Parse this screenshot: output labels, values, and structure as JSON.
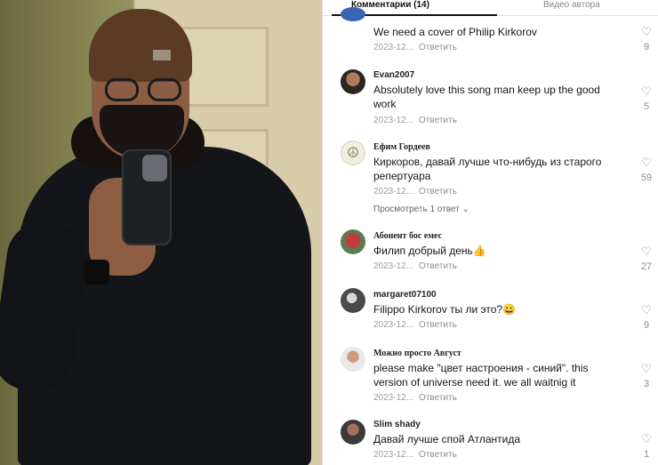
{
  "tabs": [
    {
      "label": "Комментарии (14)"
    },
    {
      "label": "Видео автора"
    }
  ],
  "comments": [
    {
      "author": "",
      "text": "We need a cover of Philip Kirkorov",
      "date": "2023-12...",
      "reply": "Ответить",
      "likes": "9"
    },
    {
      "author": "Evan2007",
      "text": "Absolutely love this song man keep up the good work",
      "date": "2023-12...",
      "reply": "Ответить",
      "likes": "5"
    },
    {
      "author": "Ефим Гордеев",
      "text": "Киркоров, давай лучше что-нибудь из старого репертуара",
      "date": "2023-12...",
      "reply": "Ответить",
      "likes": "59",
      "view_replies": "Просмотреть 1 ответ ⌄"
    },
    {
      "author": "Абонент бос емес",
      "text": "Филип добрый день👍",
      "date": "2023-12...",
      "reply": "Ответить",
      "likes": "27"
    },
    {
      "author": "margaret07100",
      "text": "Filippo Kirkorov ты ли это?😀",
      "date": "2023-12...",
      "reply": "Ответить",
      "likes": "9"
    },
    {
      "author": "Можно просто Август",
      "text": "please make \"цвет настроения - синий\". this version of universe need it. we all waitnig it",
      "date": "2023-12...",
      "reply": "Ответить",
      "likes": "3"
    },
    {
      "author": "Slim shady",
      "text": "Давай лучше спой Атлантида",
      "date": "2023-12...",
      "reply": "Ответить",
      "likes": "1"
    }
  ],
  "icons": {
    "like": "heart-outline-icon",
    "chevron": "chevron-down-icon"
  },
  "colors": {
    "text": "#161616",
    "meta": "#9b9b9b",
    "tab_active": "#111111"
  }
}
